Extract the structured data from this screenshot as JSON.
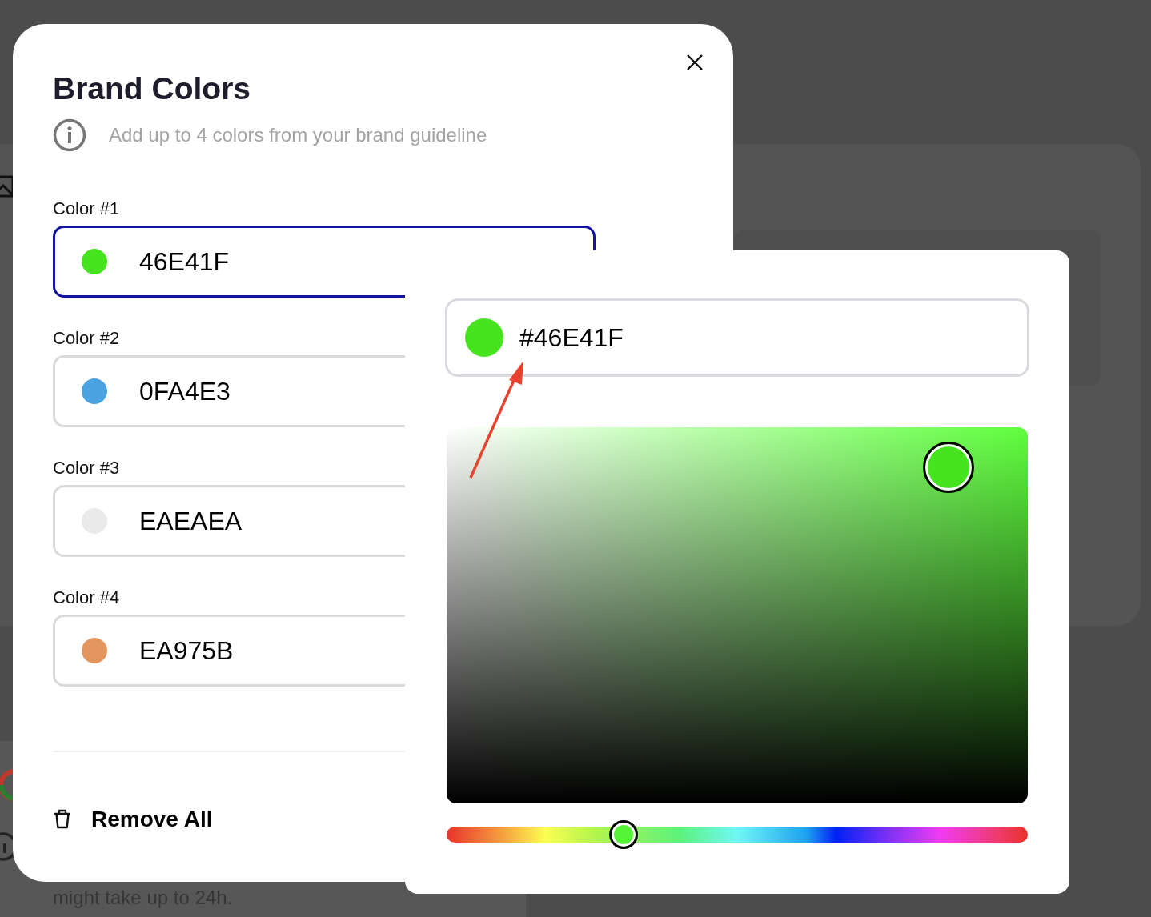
{
  "background": {
    "note": "might take up to 24h."
  },
  "modal": {
    "title": "Brand Colors",
    "hint": "Add up to 4 colors from your brand guideline",
    "fields": [
      {
        "label": "Color #1",
        "value": "46E41F",
        "color": "#46e41f",
        "selected": true
      },
      {
        "label": "Color #2",
        "value": "0FA4E3",
        "color": "#4aa3e0",
        "selected": false
      },
      {
        "label": "Color #3",
        "value": "EAEAEA",
        "color": "#eaeaea",
        "selected": false
      },
      {
        "label": "Color #4",
        "value": "EA975B",
        "color": "#e3975f",
        "selected": false
      }
    ],
    "remove_all": "Remove All"
  },
  "picker": {
    "hex": "#46E41F",
    "color": "#46e41f",
    "hue_slider": {
      "level": 0.304
    }
  }
}
